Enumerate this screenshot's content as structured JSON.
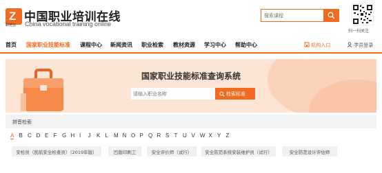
{
  "brand": {
    "logo_letter": "Z",
    "logo_sub": "职培云",
    "title": "中国职业培训在线",
    "subtitle_en": "China vocational training online"
  },
  "header_search": {
    "placeholder": "搜索课程"
  },
  "qr": {
    "caption": "扫一扫关注"
  },
  "nav": {
    "items": [
      {
        "label": "首页"
      },
      {
        "label": "国家职业技能标准"
      },
      {
        "label": "课程中心"
      },
      {
        "label": "新闻资讯"
      },
      {
        "label": "职业检索"
      },
      {
        "label": "教材资源"
      },
      {
        "label": "学习中心"
      },
      {
        "label": "帮助中心"
      }
    ],
    "active_index": 1,
    "org_entry": "机构入口",
    "student_login": "学员登录"
  },
  "banner": {
    "title": "国家职业技能标准查询系统",
    "input_placeholder": "请输入职业名称",
    "button_label": "检索标准"
  },
  "pinyin": {
    "label": "拼音检索",
    "letters": [
      "A",
      "B",
      "C",
      "D",
      "E",
      "F",
      "G",
      "H",
      "I",
      "J",
      "K",
      "L",
      "M",
      "N",
      "O",
      "P",
      "Q",
      "R",
      "S",
      "T",
      "U",
      "V",
      "W",
      "X",
      "Y",
      "Z"
    ],
    "active_letter": "A"
  },
  "tags": [
    {
      "label": "安检员（民航安全检查员）（2019年版）"
    },
    {
      "label": "凹版印刷工"
    },
    {
      "label": "安全评价师（试行）"
    },
    {
      "label": "安全防范系统安装维护员（试行）"
    },
    {
      "label": "安全防范设计评估师"
    }
  ],
  "colors": {
    "accent": "#f06a1f",
    "banner_bg": "#fde5d6",
    "tag_bg": "#f0f0f0"
  }
}
